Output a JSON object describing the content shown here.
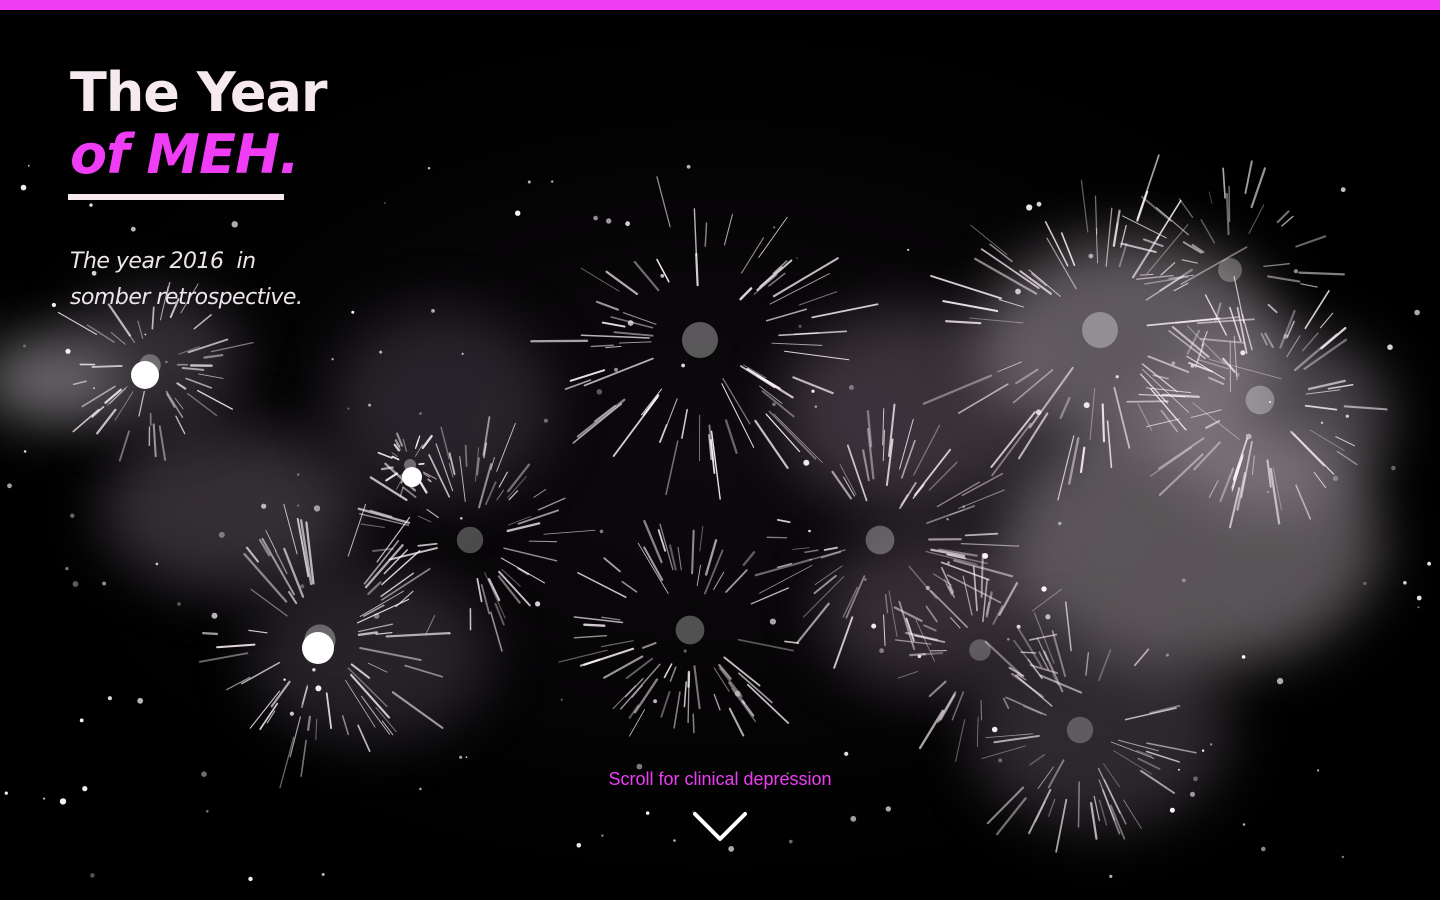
{
  "hero": {
    "title_line1": "The Year",
    "title_line2": "of MEH.",
    "subtitle_line1": "The year 2016  in",
    "subtitle_line2": "somber retrospective.",
    "scroll_label": "Scroll for clinical depression"
  },
  "colors": {
    "accent": "#ef3cf5",
    "title": "#f6eaf0",
    "background": "#000000"
  },
  "icons": {
    "scroll_arrow": "chevron-down-icon",
    "background": "fireworks-image"
  }
}
